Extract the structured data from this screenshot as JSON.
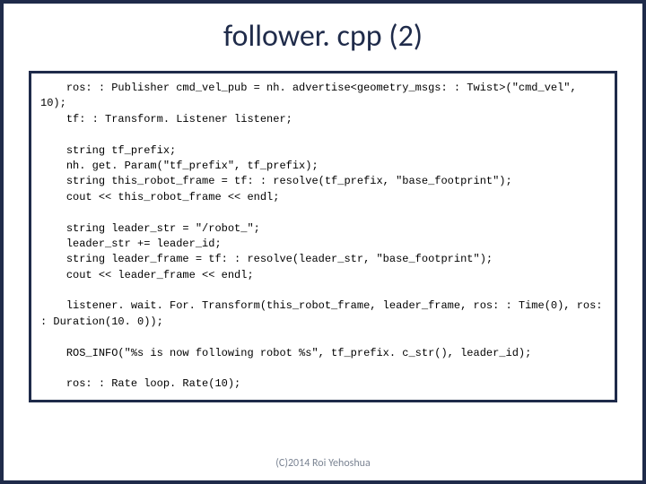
{
  "title": "follower. cpp (2)",
  "credit": "(C)2014 Roi Yehoshua",
  "code": "    ros: : Publisher cmd_vel_pub = nh. advertise<geometry_msgs: : Twist>(\"cmd_vel\", 10);\n    tf: : Transform. Listener listener;\n\n    string tf_prefix;\n    nh. get. Param(\"tf_prefix\", tf_prefix);\n    string this_robot_frame = tf: : resolve(tf_prefix, \"base_footprint\");\n    cout << this_robot_frame << endl;\n\n    string leader_str = \"/robot_\";\n    leader_str += leader_id;\n    string leader_frame = tf: : resolve(leader_str, \"base_footprint\");\n    cout << leader_frame << endl;\n\n    listener. wait. For. Transform(this_robot_frame, leader_frame, ros: : Time(0), ros: : Duration(10. 0));\n\n    ROS_INFO(\"%s is now following robot %s\", tf_prefix. c_str(), leader_id);\n\n    ros: : Rate loop. Rate(10);"
}
